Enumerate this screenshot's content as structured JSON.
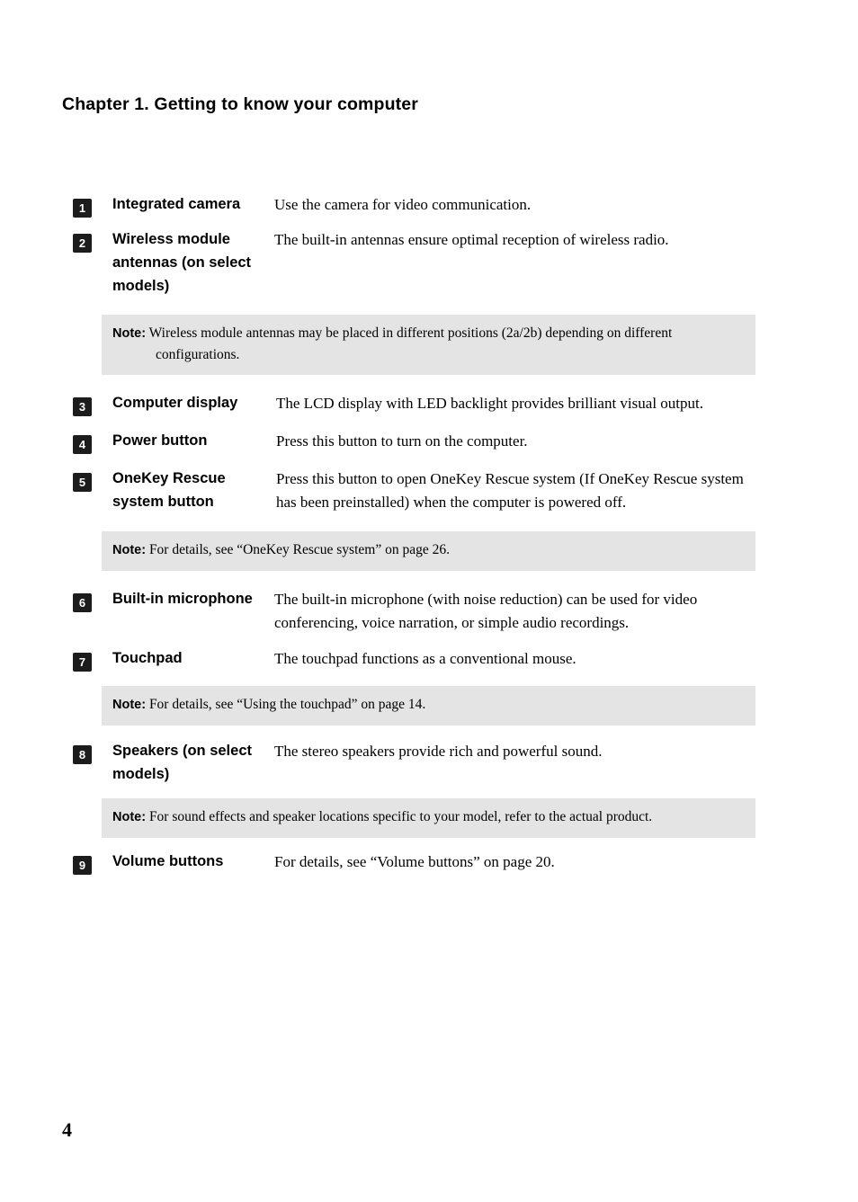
{
  "header": {
    "chapter_title": "Chapter 1. Getting to know your computer"
  },
  "footer": {
    "page_number": "4"
  },
  "note_label": "Note:",
  "items": [
    {
      "number": "1",
      "label": "Integrated camera",
      "description": "Use the camera for video communication."
    },
    {
      "number": "2",
      "label": "Wireless module antennas (on select models)",
      "description": "The built-in antennas ensure optimal reception of wireless radio."
    },
    {
      "number": "3",
      "label": "Computer display",
      "description": "The LCD display with LED backlight provides brilliant visual output."
    },
    {
      "number": "4",
      "label": "Power button",
      "description": "Press this button to turn on the computer."
    },
    {
      "number": "5",
      "label": "OneKey Rescue system button",
      "description": "Press this button to open OneKey Rescue system (If OneKey Rescue system has been preinstalled) when the computer is powered off."
    },
    {
      "number": "6",
      "label": "Built-in microphone",
      "description": "The built-in microphone (with noise reduction) can be used for video conferencing, voice narration, or simple audio recordings."
    },
    {
      "number": "7",
      "label": "Touchpad",
      "description": "The touchpad functions as a conventional mouse."
    },
    {
      "number": "8",
      "label": "Speakers (on select models)",
      "description": "The stereo speakers provide rich and powerful sound."
    },
    {
      "number": "9",
      "label": "Volume buttons",
      "description": "For details, see “Volume buttons” on page 20."
    }
  ],
  "notes": [
    {
      "text": "Wireless module antennas may be placed in different positions (2a/2b) depending on different configurations."
    },
    {
      "text": "For details, see “OneKey Rescue system” on page 26."
    },
    {
      "text": "For details, see “Using the touchpad” on page 14."
    },
    {
      "text": "For sound effects and speaker locations specific to your model, refer to the actual product."
    }
  ],
  "colors": {
    "note_background": "#e4e4e4",
    "badge_background": "#1c1c1c",
    "text": "#000000"
  }
}
